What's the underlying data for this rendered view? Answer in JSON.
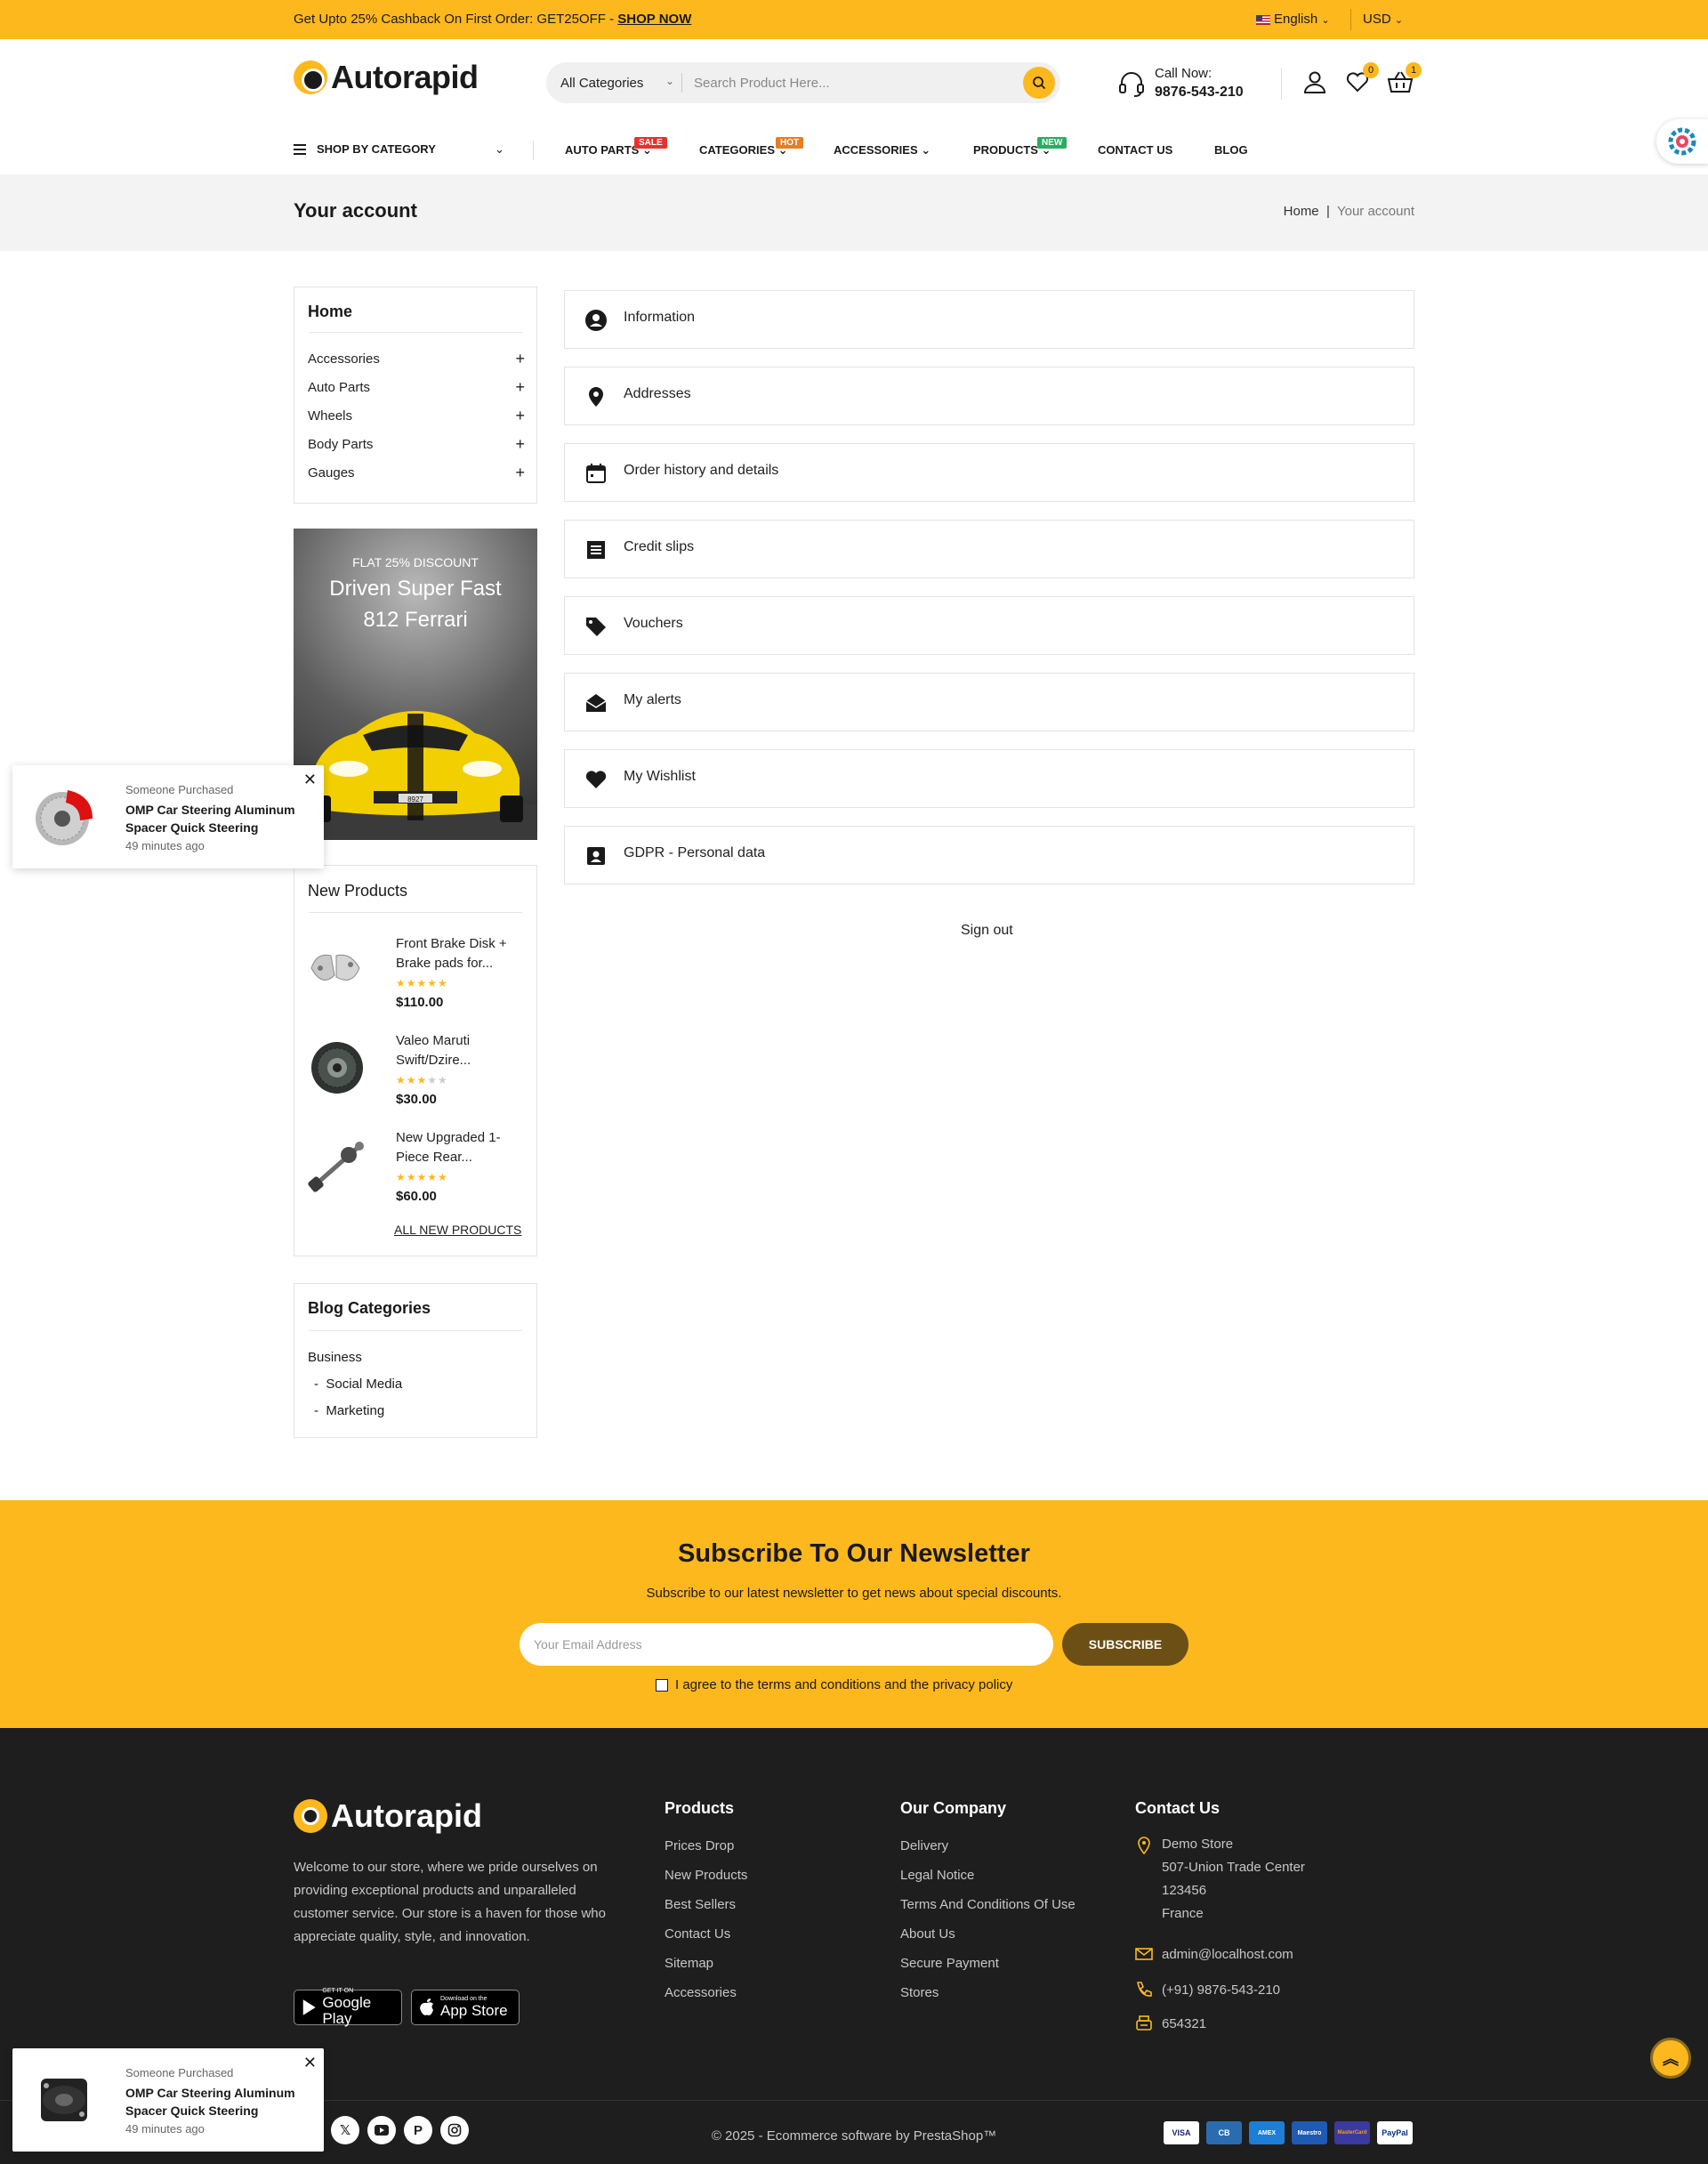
{
  "topbar": {
    "promo": "Get Upto 25% Cashback On First Order: GET25OFF - ",
    "promo_link": "SHOP NOW",
    "language": "English",
    "currency": "USD"
  },
  "header": {
    "logo": "Autorapid",
    "search_category": "All Categories",
    "search_placeholder": "Search Product Here...",
    "call_label": "Call Now:",
    "call_number": "9876-543-210",
    "wishlist_count": "0",
    "cart_count": "1"
  },
  "nav": {
    "shop_by_category": "SHOP BY CATEGORY",
    "items": [
      {
        "label": "AUTO PARTS",
        "tag": "SALE",
        "tag_color": "#e5322d"
      },
      {
        "label": "CATEGORIES",
        "tag": "HOT",
        "tag_color": "#e67e22"
      },
      {
        "label": "ACCESSORIES",
        "tag": "",
        "tag_color": ""
      },
      {
        "label": "PRODUCTS",
        "tag": "NEW",
        "tag_color": "#27ae60"
      },
      {
        "label": "CONTACT US",
        "tag": "",
        "tag_color": ""
      },
      {
        "label": "BLOG",
        "tag": "",
        "tag_color": ""
      }
    ]
  },
  "page": {
    "title": "Your account",
    "breadcrumb_home": "Home",
    "breadcrumb_sep": "|",
    "breadcrumb_current": "Your account"
  },
  "sidebar": {
    "home": "Home",
    "categories": [
      "Accessories",
      "Auto Parts",
      "Wheels",
      "Body Parts",
      "Gauges"
    ],
    "banner_line1": "FLAT 25% DISCOUNT",
    "banner_line2": "Driven Super Fast",
    "banner_line3": "812 Ferrari",
    "banner_plate": "8927",
    "new_products_title": "New Products",
    "new_products": [
      {
        "name": "Front Brake Disk + Brake pads for...",
        "rating": 5,
        "price": "$110.00"
      },
      {
        "name": "Valeo Maruti Swift/Dzire...",
        "rating": 3,
        "price": "$30.00"
      },
      {
        "name": "New Upgraded 1-Piece Rear...",
        "rating": 5,
        "price": "$60.00"
      }
    ],
    "all_new_products": "ALL NEW PRODUCTS",
    "blog_title": "Blog Categories",
    "blog_items": [
      "Business",
      "Social Media",
      "Marketing"
    ]
  },
  "account_links": [
    {
      "label": "Information",
      "icon": "user-circle-icon"
    },
    {
      "label": "Addresses",
      "icon": "map-pin-icon"
    },
    {
      "label": "Order history and details",
      "icon": "calendar-icon"
    },
    {
      "label": "Credit slips",
      "icon": "receipt-icon"
    },
    {
      "label": "Vouchers",
      "icon": "tag-icon"
    },
    {
      "label": "My alerts",
      "icon": "envelope-open-icon"
    },
    {
      "label": "My Wishlist",
      "icon": "heart-icon"
    },
    {
      "label": "GDPR - Personal data",
      "icon": "id-card-icon"
    }
  ],
  "sign_out": "Sign out",
  "newsletter": {
    "title": "Subscribe To Our Newsletter",
    "subtitle": "Subscribe to our latest newsletter to get news about special discounts.",
    "placeholder": "Your Email Address",
    "button": "SUBSCRIBE",
    "agree": "I agree to the terms and conditions and the privacy policy"
  },
  "footer": {
    "logo": "Autorapid",
    "description": "Welcome to our store, where we pride ourselves on providing exceptional products and unparalleled customer service. Our store is a haven for those who appreciate quality, style, and innovation.",
    "google_play_small": "GET IT ON",
    "google_play": "Google Play",
    "app_store_small": "Download on the",
    "app_store": "App Store",
    "products_title": "Products",
    "products_links": [
      "Prices Drop",
      "New Products",
      "Best Sellers",
      "Contact Us",
      "Sitemap",
      "Accessories"
    ],
    "company_title": "Our Company",
    "company_links": [
      "Delivery",
      "Legal Notice",
      "Terms And Conditions Of Use",
      "About Us",
      "Secure Payment",
      "Stores"
    ],
    "contact_title": "Contact Us",
    "address": [
      "Demo Store",
      "507-Union Trade Center",
      "123456",
      "France"
    ],
    "email": "admin@localhost.com",
    "phone": "(+91) 9876-543-210",
    "fax": "654321",
    "copyright": "© 2025 - Ecommerce software by PrestaShop™",
    "payments": [
      "VISA",
      "CB",
      "AMEX",
      "Maestro",
      "MasterCard",
      "PayPal"
    ]
  },
  "popups": [
    {
      "label": "Someone Purchased",
      "product": "OMP Car Steering Aluminum Spacer Quick Steering",
      "time": "49 minutes ago"
    },
    {
      "label": "Someone Purchased",
      "product": "OMP Car Steering Aluminum Spacer Quick Steering",
      "time": "49 minutes ago"
    }
  ],
  "colors": {
    "accent": "#fdb81e",
    "footer_bg": "#1e1e1e",
    "subscribe_btn": "#6b4f15"
  }
}
